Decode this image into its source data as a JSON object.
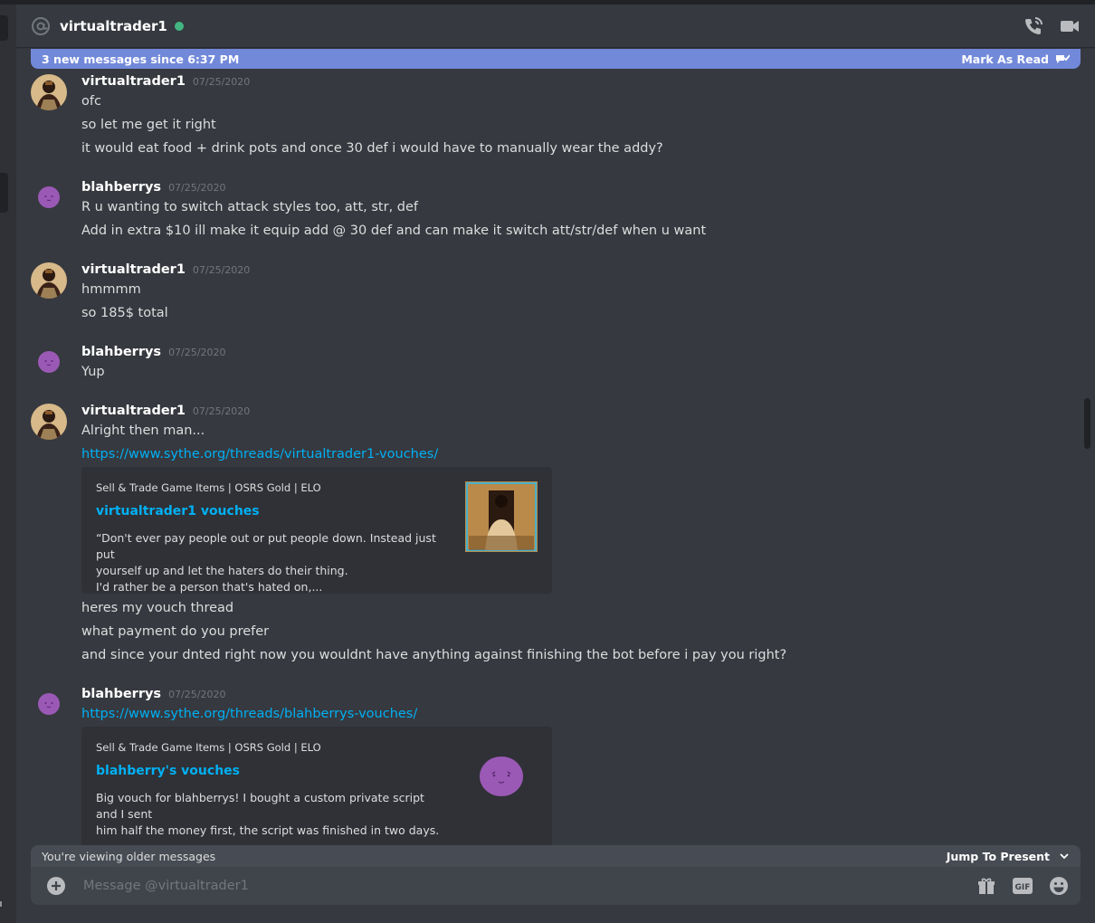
{
  "header": {
    "recipient": "virtualtrader1",
    "status": "online",
    "icons": [
      "at-sign-icon",
      "voice-call-icon",
      "video-call-icon"
    ]
  },
  "new_messages_bar": {
    "text": "3 new messages since 6:37 PM",
    "action": "Mark As Read"
  },
  "groups": [
    {
      "author": "virtualtrader1",
      "timestamp": "07/25/2020",
      "avatar": "user-avatar",
      "lines": [
        "ofc",
        "so let me get it right",
        "it would eat food + drink pots and once 30 def i would have to manually wear the addy?"
      ]
    },
    {
      "author": "blahberrys",
      "timestamp": "07/25/2020",
      "avatar": "berry-avatar",
      "lines": [
        "R u wanting to switch attack styles too, att, str, def",
        "Add in extra $10 ill make it equip add @ 30 def and can make it switch att/str/def when u want"
      ]
    },
    {
      "author": "virtualtrader1",
      "timestamp": "07/25/2020",
      "avatar": "user-avatar",
      "lines": [
        "hmmmm",
        "so 185$ total"
      ]
    },
    {
      "author": "blahberrys",
      "timestamp": "07/25/2020",
      "avatar": "berry-avatar",
      "lines": [
        "Yup"
      ]
    },
    {
      "author": "virtualtrader1",
      "timestamp": "07/25/2020",
      "avatar": "user-avatar",
      "lines": [
        "Alright then man..."
      ],
      "link": "https://www.sythe.org/threads/virtualtrader1-vouches/",
      "embed": {
        "provider": "Sell & Trade Game Items | OSRS Gold | ELO",
        "title": "virtualtrader1 vouches",
        "description": [
          "“Don't ever pay people out or put people down. Instead just put",
          "yourself up and let the haters do their thing.",
          "I'd rather be a person that's hated on,..."
        ]
      },
      "after_lines": [
        "heres my vouch thread",
        "what payment do you prefer",
        "and since your dnted right now you wouldnt have anything against finishing the bot before i pay you right?"
      ]
    },
    {
      "author": "blahberrys",
      "timestamp": "07/25/2020",
      "avatar": "berry-avatar",
      "link": "https://www.sythe.org/threads/blahberrys-vouches/",
      "embed": {
        "provider": "Sell & Trade Game Items | OSRS Gold | ELO",
        "title": "blahberry's vouches",
        "description": [
          "Big vouch for blahberrys! I bought a custom private script and I sent",
          "him half the money first, the script was finished in two days."
        ]
      }
    }
  ],
  "older_bar": {
    "text": "You're viewing older messages",
    "action": "Jump To Present"
  },
  "composer": {
    "placeholder": "Message @virtualtrader1",
    "gif_label": "GIF",
    "icons": [
      "add-attachment-icon",
      "gift-icon",
      "gif-icon",
      "emoji-icon"
    ]
  },
  "colors": {
    "background": "#36393f",
    "accent": "#7289da",
    "link": "#00b0f4",
    "online": "#43b581",
    "embed_bg": "#2f3136",
    "berry": "#9b59b6"
  }
}
